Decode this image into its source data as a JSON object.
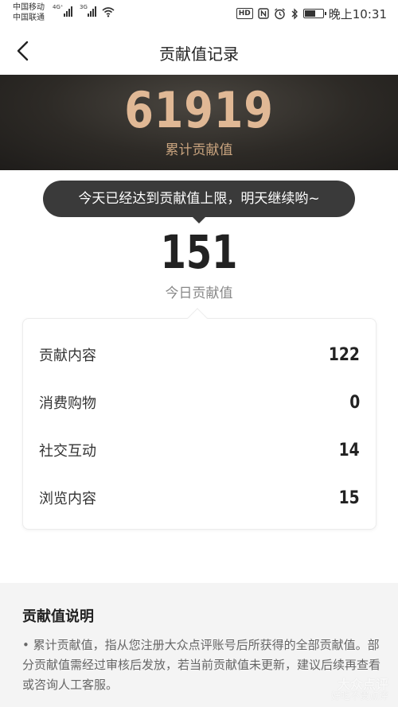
{
  "status_bar": {
    "carrier_1": "中国移动",
    "carrier_2": "中国联通",
    "network_1": "4G⁺",
    "network_2": "3G",
    "time": "晚上10:31",
    "hd_badge": "HD",
    "nfc_icon": "nfc-icon",
    "alarm_icon": "alarm-icon",
    "bluetooth_icon": "bluetooth-icon",
    "battery_level": 0.55
  },
  "nav": {
    "title": "贡献值记录",
    "back_icon": "chevron-left-icon"
  },
  "hero": {
    "total_value": "61919",
    "total_label": "累计贡献值"
  },
  "tooltip": {
    "text": "今天已经达到贡献值上限，明天继续哟~"
  },
  "today": {
    "value": "151",
    "label": "今日贡献值"
  },
  "breakdown": [
    {
      "label": "贡献内容",
      "value": "122"
    },
    {
      "label": "消费购物",
      "value": "0"
    },
    {
      "label": "社交互动",
      "value": "14"
    },
    {
      "label": "浏览内容",
      "value": "15"
    }
  ],
  "explanation": {
    "title": "贡献值说明",
    "text": "• 累计贡献值，指从您注册大众点评账号后所获得的全部贡献值。部分贡献值需经过审核后发放，若当前贡献值未更新，建议后续再查看或咨询人工客服。"
  },
  "watermark": {
    "logo_text": "大众点评",
    "tagline": "好吃不贵点评"
  },
  "colors": {
    "hero_bg": "#2d2a26",
    "hero_value": "#e0b895",
    "tooltip_bg": "#3a3a3a",
    "explain_bg": "#f4f4f4"
  }
}
